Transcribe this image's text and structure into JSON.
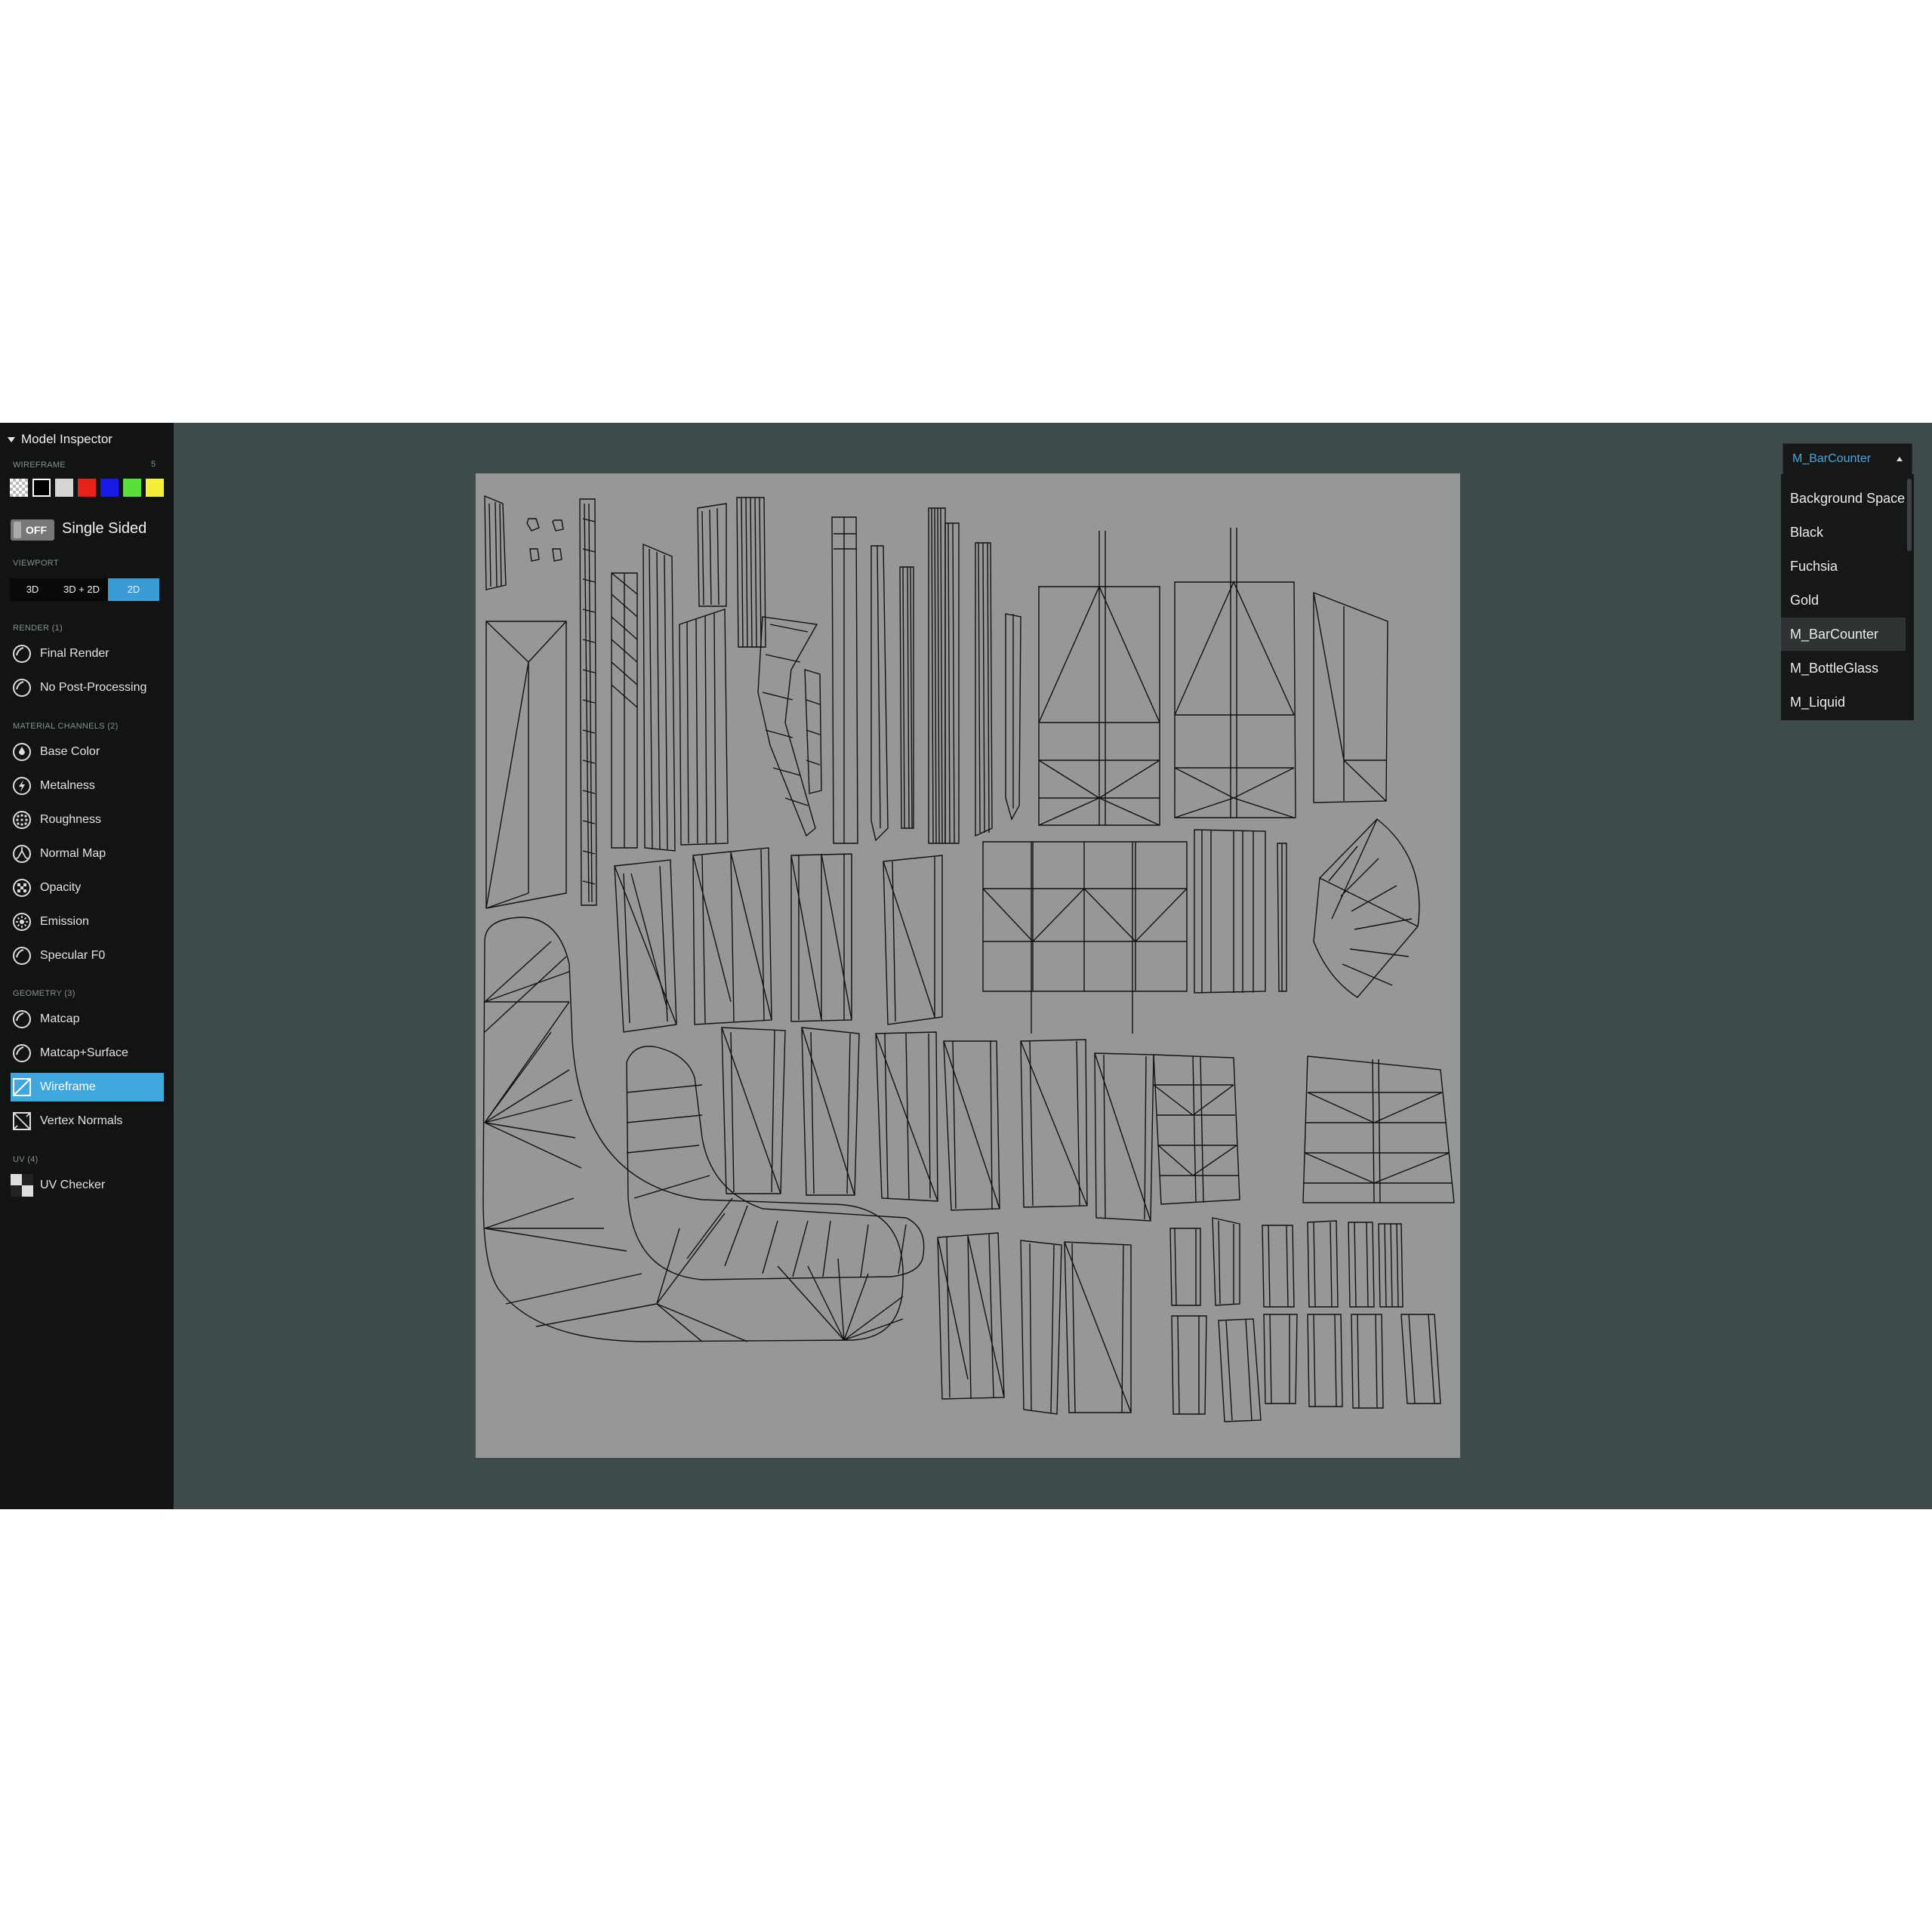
{
  "sidebar": {
    "title": "Model Inspector",
    "wireframe_section": "WIREFRAME",
    "wireframe_count": "5",
    "swatch_colors": [
      "checker",
      "#000000",
      "#d5d5d5",
      "#e8201e",
      "#1a1ae6",
      "#5ae03c",
      "#f4f03a"
    ],
    "single_sided": {
      "state": "OFF",
      "label": "Single Sided"
    },
    "viewport_section": "VIEWPORT",
    "viewport_buttons": [
      "3D",
      "3D + 2D",
      "2D"
    ],
    "viewport_selected": "2D",
    "render_section": "RENDER (1)",
    "render_items": [
      "Final Render",
      "No Post-Processing"
    ],
    "channels_section": "MATERIAL CHANNELS (2)",
    "channel_items": [
      "Base Color",
      "Metalness",
      "Roughness",
      "Normal Map",
      "Opacity",
      "Emission",
      "Specular F0"
    ],
    "geometry_section": "GEOMETRY (3)",
    "geometry_items": [
      "Matcap",
      "Matcap+Surface",
      "Wireframe",
      "Vertex Normals"
    ],
    "geometry_selected": "Wireframe",
    "uv_section": "UV (4)",
    "uv_items": [
      "UV Checker"
    ]
  },
  "material_dropdown": {
    "selected": "M_BarCounter",
    "options": [
      "Background Space",
      "Black",
      "Fuchsia",
      "Gold",
      "M_BarCounter",
      "M_BottleGlass",
      "M_Liquid"
    ]
  },
  "colors": {
    "accent": "#40a7dc",
    "viewport_bg": "#3f4a4a",
    "uv_canvas": "#969797",
    "sidebar_bg": "#121414"
  }
}
